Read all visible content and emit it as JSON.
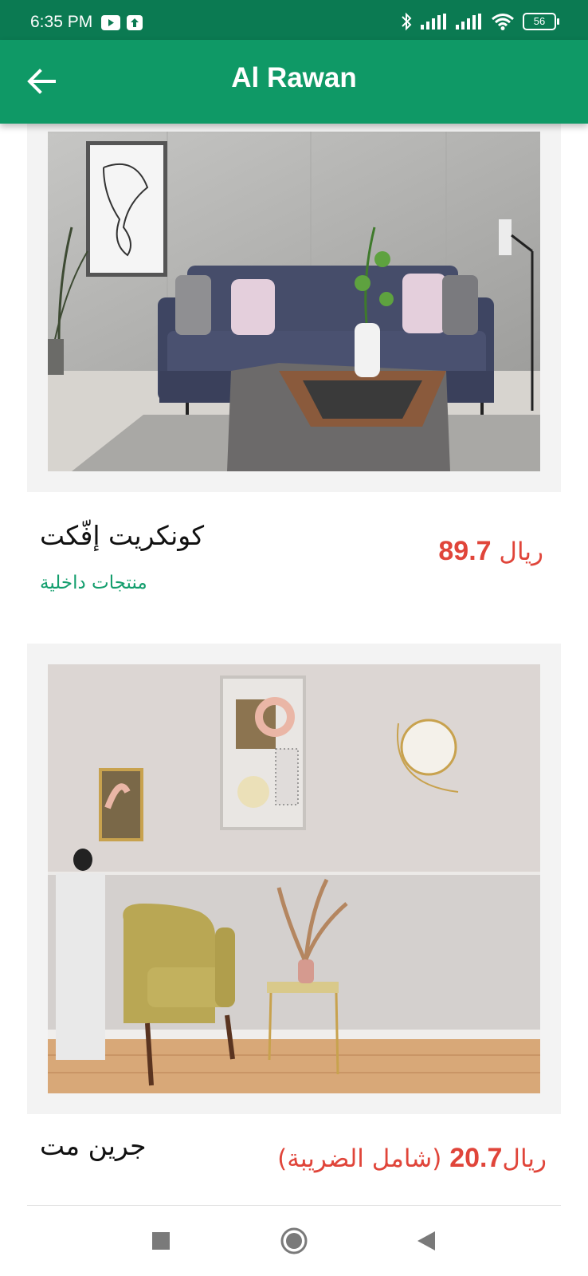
{
  "status_bar": {
    "time": "6:35 PM",
    "battery": "56",
    "left_icons": [
      "youtube-icon",
      "upload-icon"
    ],
    "right_icons": [
      "bluetooth-icon",
      "signal-icon",
      "signal-icon",
      "wifi-icon",
      "battery-icon"
    ]
  },
  "app_bar": {
    "title": "Al Rawan",
    "back_icon": "arrow-left-icon"
  },
  "products": [
    {
      "name": "كونكريت إفّكت",
      "category": "منتجات داخلية",
      "price_currency": "ريال",
      "price_value": "89.7",
      "price_suffix": ""
    },
    {
      "name": "جرين مت",
      "category": "",
      "price_currency": "ريال",
      "price_value": "20.7",
      "price_suffix": "(شامل الضريبة)"
    }
  ],
  "nav_bar": {
    "icons": [
      "recent-apps-icon",
      "home-icon",
      "back-triangle-icon"
    ]
  },
  "colors": {
    "status_bar": "#0b7a52",
    "app_bar": "#0f9966",
    "price": "#e0453a",
    "category": "#139e6d"
  }
}
